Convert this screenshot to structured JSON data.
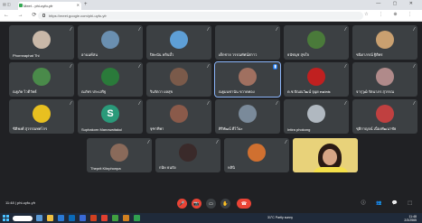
{
  "browser": {
    "tab_title": "Meet - phi-uyfo-yfr",
    "url": "https://meet.google.com/phi-uyfo-yfr",
    "new_tab": "+",
    "controls": "— ▢ ✕",
    "nav": "← → ⟳",
    "toolbar_icons": "☆ ⋮ ⊕ ⋮"
  },
  "participants": [
    {
      "name": "Phornnaphat Thi",
      "color": "#c9b8a8",
      "type": "photo"
    },
    {
      "name": "อานนท์สน",
      "color": "#6a8fb0",
      "type": "photo"
    },
    {
      "name": "ปิยะนัน หลินบั้ว",
      "color": "#5e9fd6",
      "type": "photo"
    },
    {
      "name": "เด็กชาย วรรณทัศน์สกาว",
      "color": "#3c4043",
      "type": "none"
    },
    {
      "name": "ธนัชนุช สุขใจ",
      "color": "#4a7a3a",
      "type": "photo"
    },
    {
      "name": "ชนิดาภรณ์ ฐิติพร",
      "color": "#c9a070",
      "type": "photo"
    },
    {
      "name": "ณฐภัค ไวดีวัทธ์",
      "color": "#4a8a4a",
      "type": "photo"
    },
    {
      "name": "ณภัทร ประเสริฐ",
      "color": "#2a7a3a",
      "type": "photo"
    },
    {
      "name": "รินรัตวา ผลสุข",
      "color": "#7a5a4a",
      "type": "photo"
    },
    {
      "name": "ณฐมนชานัน ขวาดทอง",
      "color": "#a07060",
      "type": "photo"
    },
    {
      "name": "ด.ช.ปัณณวัฒน์ จุนุย ๓๑/๓๒",
      "color": "#c02020",
      "type": "photo"
    },
    {
      "name": "จารุวุฒิ รัตนาภร สุวรรณ",
      "color": "#b08a8a",
      "type": "photo"
    },
    {
      "name": "ชิติพงศ์ สุวรรณทศโกร",
      "color": "#e8c020",
      "type": "photo"
    },
    {
      "name": "Suphakorn Manowattakul",
      "color": "#2a9a7a",
      "type": "letter",
      "letter": "S"
    },
    {
      "name": "จุฑาทิพา",
      "color": "#8a5a4a",
      "type": "photo"
    },
    {
      "name": "ศิริพัฒน์ ดีไว้นะ",
      "color": "#7a8a9a",
      "type": "photo"
    },
    {
      "name": "Intira phokong",
      "color": "#b0b8c0",
      "type": "photo"
    },
    {
      "name": "ชุติกาญจน์ เนื่องพัฒนาชัย",
      "color": "#c04040",
      "type": "photo"
    },
    {
      "name": "Theprit Klinphonpa",
      "color": "#8a6a5a",
      "type": "photo"
    },
    {
      "name": "กนิษ ธนปัง",
      "color": "#3a2a2a",
      "type": "photo"
    },
    {
      "name": "หลินิ",
      "color": "#d07030",
      "type": "photo"
    }
  ],
  "active_speaker_index": 9,
  "meeting": {
    "time": "11:48",
    "code": "phi-uyfo-yfr",
    "separator": "|"
  },
  "controls": [
    "🎤",
    "📷",
    "▭",
    "✋",
    "⋮"
  ],
  "end_call": "☎",
  "right_controls": "ⓘ 👥 💬 ⬚",
  "taskbar": {
    "weather": "31°C Partly sunny",
    "time": "11:48",
    "date": "2/3/2565"
  },
  "colors": {
    "background": "#202124",
    "tile": "#3c4043",
    "end_call": "#ea4335",
    "accent": "#1a73e8"
  }
}
